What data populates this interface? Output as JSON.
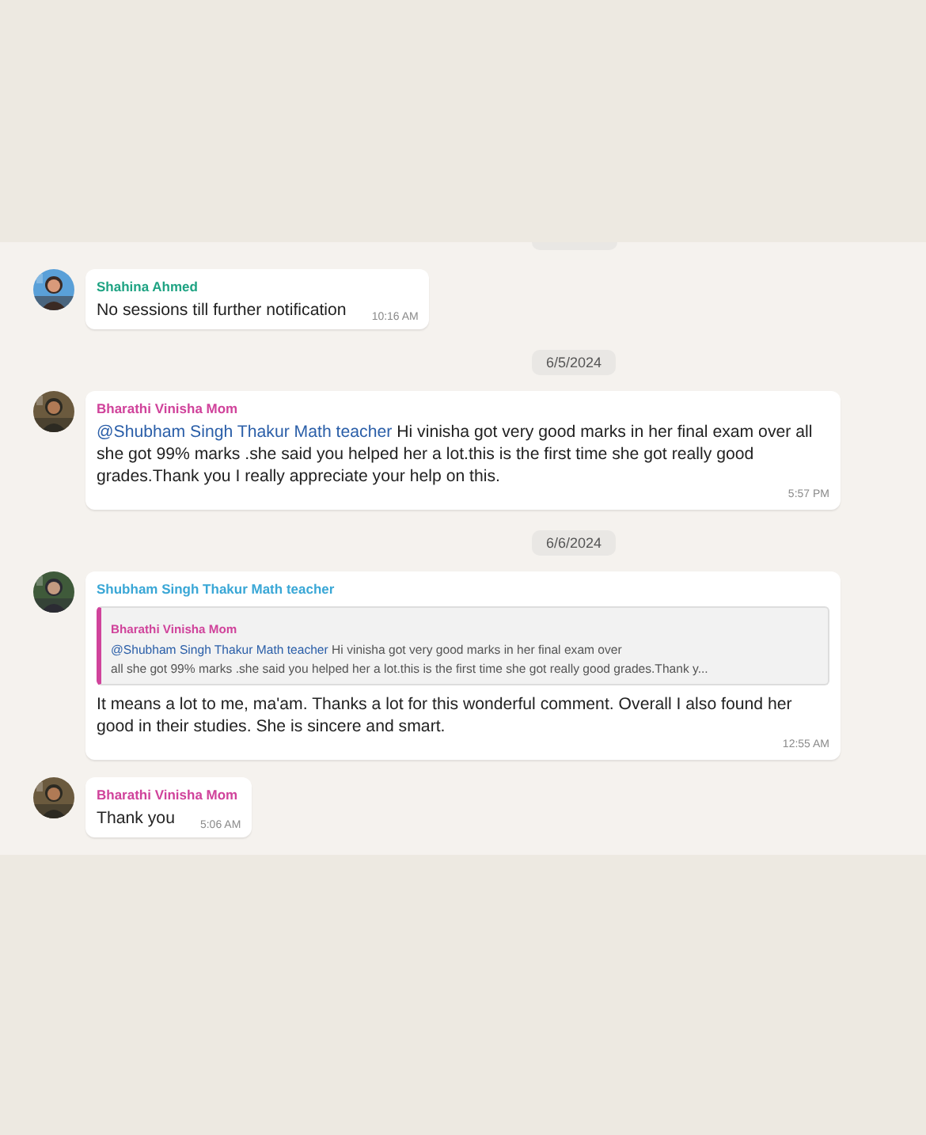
{
  "chat": {
    "items": [
      {
        "kind": "message",
        "sender": "Shahina Ahmed",
        "color": "#1fa383",
        "text": "No sessions till further notification",
        "time": "10:16 AM"
      },
      {
        "kind": "date",
        "text": "6/5/2024"
      },
      {
        "kind": "message",
        "sender": "Bharathi Vinisha Mom",
        "color": "#d0439b",
        "mention": "@Shubham Singh Thakur Math teacher",
        "text": "Hi vinisha got very good marks in her final exam over all she got 99% marks .she said you helped her a lot.this is the first time she got really good grades.Thank you I really appreciate your help on this.",
        "time": "5:57 PM"
      },
      {
        "kind": "date",
        "text": "6/6/2024"
      },
      {
        "kind": "message",
        "sender": "Shubham Singh Thakur Math teacher",
        "color": "#3aa7d6",
        "quote": {
          "sender": "Bharathi Vinisha Mom",
          "color": "#d0439b",
          "mention": "@Shubham Singh Thakur Math teacher",
          "lines": [
            "Hi vinisha got very good marks in her final exam over",
            "all she got 99% marks .she said you helped her a lot.this is the first time she got really good grades.Thank y..."
          ]
        },
        "text": "It means a lot to me, ma'am. Thanks a lot for this wonderful comment. Overall I also found her good in their studies. She is sincere and smart.",
        "time": "12:55 AM"
      },
      {
        "kind": "message",
        "sender": "Bharathi Vinisha Mom",
        "color": "#d0439b",
        "text": "Thank you",
        "time": "5:06 AM"
      }
    ]
  }
}
